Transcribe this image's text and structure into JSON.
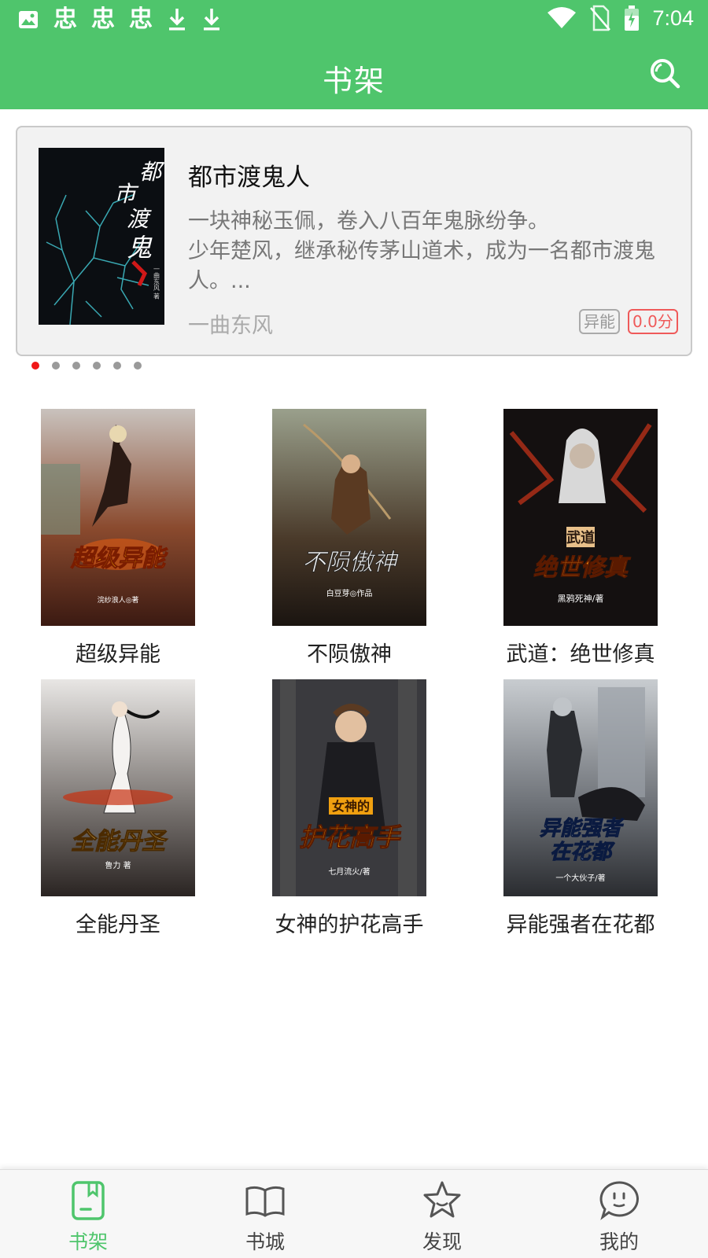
{
  "status_bar": {
    "time": "7:04",
    "app_glyphs": [
      "忠",
      "忠",
      "忠"
    ]
  },
  "header": {
    "title": "书架",
    "search_icon": "search-icon"
  },
  "featured": {
    "title": "都市渡鬼人",
    "description": "一块神秘玉佩，卷入八百年鬼脉纷争。\n少年楚风，继承秘传茅山道术，成为一名都市渡鬼人。...",
    "author": "一曲东风",
    "genre_tag": "异能",
    "score_tag": "0.0分",
    "cover_text": "都市渡鬼",
    "cover_author": "一曲东风 著",
    "carousel_count": 6,
    "carousel_active": 0
  },
  "books": [
    {
      "title": "超级异能",
      "cover_text": "超级异能",
      "cover_author": "浣纱浪人◎著"
    },
    {
      "title": "不陨傲神",
      "cover_text": "不陨傲神",
      "cover_author": "白豆芽◎作品"
    },
    {
      "title": "武道：绝世修真",
      "cover_text": "绝世修真",
      "cover_badge": "武道",
      "cover_author": "黑鸦死神/著"
    },
    {
      "title": "全能丹圣",
      "cover_text": "全能丹圣",
      "cover_author": "鲁力 著"
    },
    {
      "title": "女神的护花高手",
      "cover_text": "护花高手",
      "cover_badge": "女神的",
      "cover_author": "七月流火/著"
    },
    {
      "title": "异能强者在花都",
      "cover_text": "异能强者在花都",
      "cover_author": "一个大伙子/著"
    }
  ],
  "bottom_nav": [
    {
      "label": "书架",
      "icon": "bookshelf-icon",
      "active": true
    },
    {
      "label": "书城",
      "icon": "book-open-icon",
      "active": false
    },
    {
      "label": "发现",
      "icon": "star-icon",
      "active": false
    },
    {
      "label": "我的",
      "icon": "chat-bubble-icon",
      "active": false
    }
  ],
  "colors": {
    "primary": "#4fc56c",
    "score": "#ef5a5a",
    "dot_active": "#f01818"
  }
}
